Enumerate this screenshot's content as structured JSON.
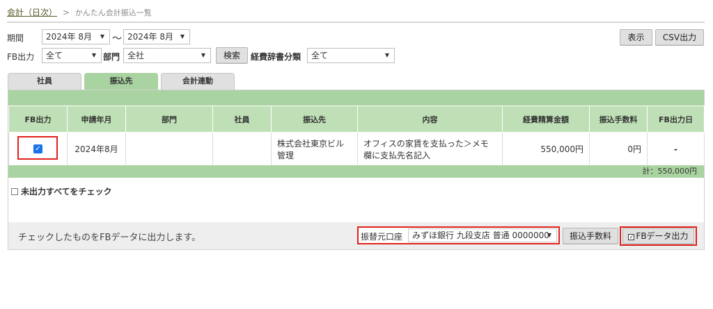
{
  "breadcrumb": {
    "parent": "会計（日次）",
    "separator": ">",
    "current": "かんたん会計振込一覧"
  },
  "filters": {
    "period_label": "期間",
    "period_from": "2024年 8月",
    "period_tilde": "〜",
    "period_to": "2024年 8月",
    "fb_label": "FB出力",
    "fb_value": "全て",
    "dept_label": "部門",
    "dept_value": "全社",
    "search_button": "検索",
    "expense_label": "経費辞書分類",
    "expense_value": "全て"
  },
  "actions": {
    "display_button": "表示",
    "csv_button": "CSV出力"
  },
  "tabs": [
    {
      "label": "社員",
      "active": false
    },
    {
      "label": "振込先",
      "active": true
    },
    {
      "label": "会計連動",
      "active": false
    }
  ],
  "table": {
    "headers": [
      "FB出力",
      "申請年月",
      "部門",
      "社員",
      "振込先",
      "内容",
      "経費精算金額",
      "振込手数料",
      "FB出力日"
    ],
    "rows": [
      {
        "fb_checked": true,
        "month": "2024年8月",
        "dept": "",
        "employee": "",
        "payee": "株式会社東京ビル管理",
        "content": "オフィスの家賃を支払った＞メモ欄に支払先名記入",
        "amount": "550,000円",
        "fee": "0円",
        "fb_date": "-"
      }
    ],
    "total": "計：550,000円"
  },
  "check_all_label": "未出力すべてをチェック",
  "footer": {
    "message": "チェックしたものをFBデータに出力します。",
    "account_label": "振替元口座",
    "account_value": "みずほ銀行 九段支店 普通 0000000",
    "fee_button": "振込手数料",
    "fb_export_button": "FBデータ出力",
    "fb_export_icon": "checkbox-icon"
  },
  "colors": {
    "tab_active": "#a9d3a0",
    "header_bg": "#bfe0b6",
    "highlight": "#e0201a",
    "checkbox": "#1a73e8"
  }
}
